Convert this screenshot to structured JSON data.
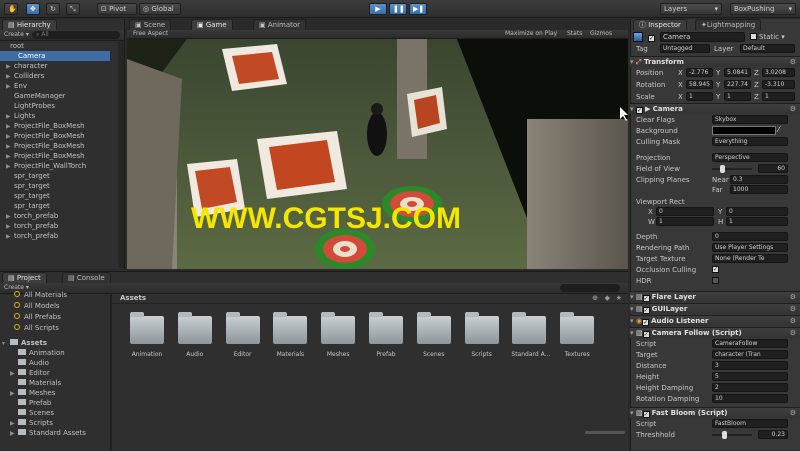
{
  "toolbar": {
    "pivot": "Pivot",
    "global": "Global",
    "layers": "Layers",
    "layout": "BoxPushing"
  },
  "hierarchy": {
    "tab": "Hierarchy",
    "create": "Create",
    "search_placeholder": "All",
    "items": [
      {
        "label": "root",
        "arrow": ""
      },
      {
        "label": "Camera",
        "arrow": ""
      },
      {
        "label": "character",
        "arrow": "▶"
      },
      {
        "label": "Colliders",
        "arrow": "▶"
      },
      {
        "label": "Env",
        "arrow": "▶"
      },
      {
        "label": "GameManager",
        "arrow": ""
      },
      {
        "label": "LightProbes",
        "arrow": ""
      },
      {
        "label": "Lights",
        "arrow": "▶"
      },
      {
        "label": "ProjectFile_BoxMesh",
        "arrow": "▶"
      },
      {
        "label": "ProjectFile_BoxMesh",
        "arrow": "▶"
      },
      {
        "label": "ProjectFile_BoxMesh",
        "arrow": "▶"
      },
      {
        "label": "ProjectFile_BoxMesh",
        "arrow": "▶"
      },
      {
        "label": "ProjectFile_WallTorch",
        "arrow": "▶"
      },
      {
        "label": "spr_target",
        "arrow": ""
      },
      {
        "label": "spr_target",
        "arrow": ""
      },
      {
        "label": "spr_target",
        "arrow": ""
      },
      {
        "label": "spr_target",
        "arrow": ""
      },
      {
        "label": "torch_prefab",
        "arrow": "▶"
      },
      {
        "label": "torch_prefab",
        "arrow": "▶"
      },
      {
        "label": "torch_prefab",
        "arrow": "▶"
      }
    ]
  },
  "center_tabs": {
    "scene": "Scene",
    "game": "Game",
    "animator": "Animator"
  },
  "game_bar": {
    "aspect": "Free Aspect",
    "maximize": "Maximize on Play",
    "stats": "Stats",
    "gizmos": "Gizmos"
  },
  "watermark": "WWW.CGTSJ.COM",
  "inspector": {
    "tab": "Inspector",
    "tab2": "Lightmapping",
    "object_name": "Camera",
    "static": "Static",
    "tag_label": "Tag",
    "tag_value": "Untagged",
    "layer_label": "Layer",
    "layer_value": "Default",
    "transform": {
      "title": "Transform",
      "position_label": "Position",
      "pos_x": "-2.776",
      "pos_y": "5.0841",
      "pos_z": "3.0208",
      "rotation_label": "Rotation",
      "rot_x": "58.945",
      "rot_y": "227.74",
      "rot_z": "-3.310",
      "scale_label": "Scale",
      "sc_x": "1",
      "sc_y": "1",
      "sc_z": "1",
      "x": "X",
      "y": "Y",
      "z": "Z"
    },
    "camera": {
      "title": "Camera",
      "clear_flags": "Clear Flags",
      "clear_flags_val": "Skybox",
      "background": "Background",
      "culling_mask": "Culling Mask",
      "culling_mask_val": "Everything",
      "projection": "Projection",
      "projection_val": "Perspective",
      "fov": "Field of View",
      "fov_val": "60",
      "clipping": "Clipping Planes",
      "near": "Near",
      "near_val": "0.3",
      "far": "Far",
      "far_val": "1000",
      "viewport": "Viewport Rect",
      "vx": "0",
      "vy": "0",
      "vw": "1",
      "vh": "1",
      "x": "X",
      "y": "Y",
      "w": "W",
      "h": "H",
      "depth": "Depth",
      "depth_val": "0",
      "rendering_path": "Rendering Path",
      "rendering_path_val": "Use Player Settings",
      "target_texture": "Target Texture",
      "target_texture_val": "None (Render Te",
      "occlusion": "Occlusion Culling",
      "hdr": "HDR"
    },
    "flare": "Flare Layer",
    "guilayer": "GUILayer",
    "audio": "Audio Listener",
    "follow": {
      "title": "Camera Follow (Script)",
      "script": "Script",
      "script_val": "CameraFollow",
      "target": "Target",
      "target_val": "character (Tran",
      "distance": "Distance",
      "distance_val": "3",
      "height": "Height",
      "height_val": "5",
      "height_damping": "Height Damping",
      "height_damping_val": "2",
      "rotation_damping": "Rotation Damping",
      "rotation_damping_val": "10"
    },
    "bloom": {
      "title": "Fast Bloom (Script)",
      "script": "Script",
      "script_val": "FastBloom",
      "threshold": "Threshhold",
      "threshold_val": "0.23"
    }
  },
  "project": {
    "tab": "Project",
    "tab2": "Console",
    "create": "Create",
    "favorites": [
      "All Materials",
      "All Models",
      "All Prefabs",
      "All Scripts"
    ],
    "assets_root": "Assets",
    "tree": [
      "Animation",
      "Audio",
      "Editor",
      "Materials",
      "Meshes",
      "Prefab",
      "Scenes",
      "Scripts",
      "Standard Assets"
    ],
    "breadcrumb": "Assets",
    "folders": [
      "Animation",
      "Audio",
      "Editor",
      "Materials",
      "Meshes",
      "Prefab",
      "Scenes",
      "Scripts",
      "Standard A...",
      "Textures"
    ]
  },
  "colors": {
    "accent": "#3e6da3",
    "watermark": "#f5e600",
    "play_active": "#4f8fd6"
  }
}
